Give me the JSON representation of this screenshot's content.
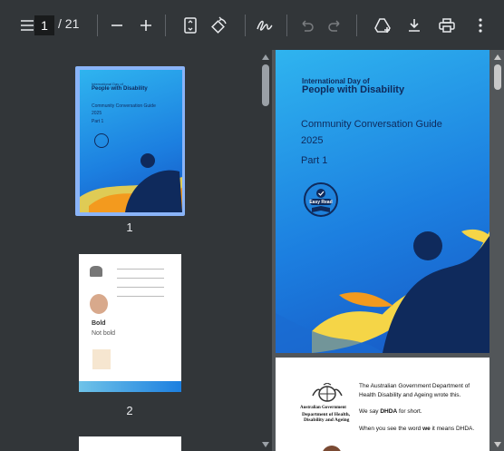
{
  "toolbar": {
    "current_page": "1",
    "total_pages": "/ 21"
  },
  "thumbnails": [
    {
      "label": "1"
    },
    {
      "label": "2"
    }
  ],
  "cover": {
    "line1": "International Day of",
    "line2": "People with Disability",
    "guide": "Community Conversation Guide",
    "year": "2025",
    "part": "Part 1",
    "badge": "Easy Read"
  },
  "page2": {
    "gov_name": "Australian Government",
    "dept1": "Department of Health,",
    "dept2": "Disability and Ageing",
    "p1": "The Australian Government Department of Health Disability and Ageing wrote this.",
    "p2a": "We say ",
    "p2b": "DHDA",
    "p2c": " for short.",
    "p3a": "When you see the word ",
    "p3b": "we",
    "p3c": " it means DHDA."
  },
  "thumb2": {
    "bold": "Bold",
    "notbold": "Not bold"
  },
  "colors": {
    "toolbar": "#323639",
    "viewer": "#525659",
    "cover_blue": "#1c7fe0",
    "navy": "#0f2a5c",
    "orange": "#f39a1e",
    "yellow": "#f5d547"
  }
}
